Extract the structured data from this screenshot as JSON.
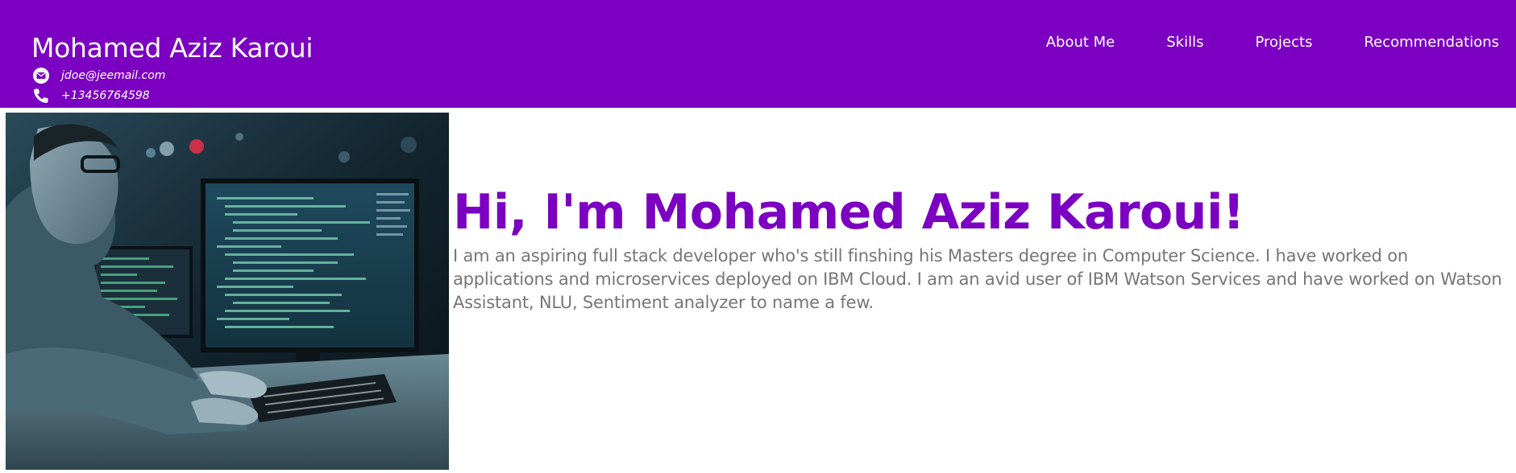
{
  "header": {
    "site_name": "Mohamed Aziz Karoui",
    "email": "jdoe@jeemail.com",
    "phone": "+13456764598",
    "email_icon": "envelope-icon",
    "phone_icon": "phone-icon",
    "background_color": "#7b00c1"
  },
  "nav": {
    "items": [
      {
        "label": "About Me"
      },
      {
        "label": "Skills"
      },
      {
        "label": "Projects"
      },
      {
        "label": "Recommendations"
      }
    ]
  },
  "hero": {
    "image_subject": "developer-at-computer-photo",
    "heading": "Hi, I'm Mohamed Aziz Karoui!",
    "bio": "I am an aspiring full stack developer who's still finshing his Masters degree in Computer Science. I have worked on applications and microservices deployed on IBM Cloud. I am an avid user of IBM Watson Services and have worked on Watson Assistant, NLU, Sentiment analyzer to name a few.",
    "heading_color": "#7b00c1",
    "text_color": "#767676"
  }
}
